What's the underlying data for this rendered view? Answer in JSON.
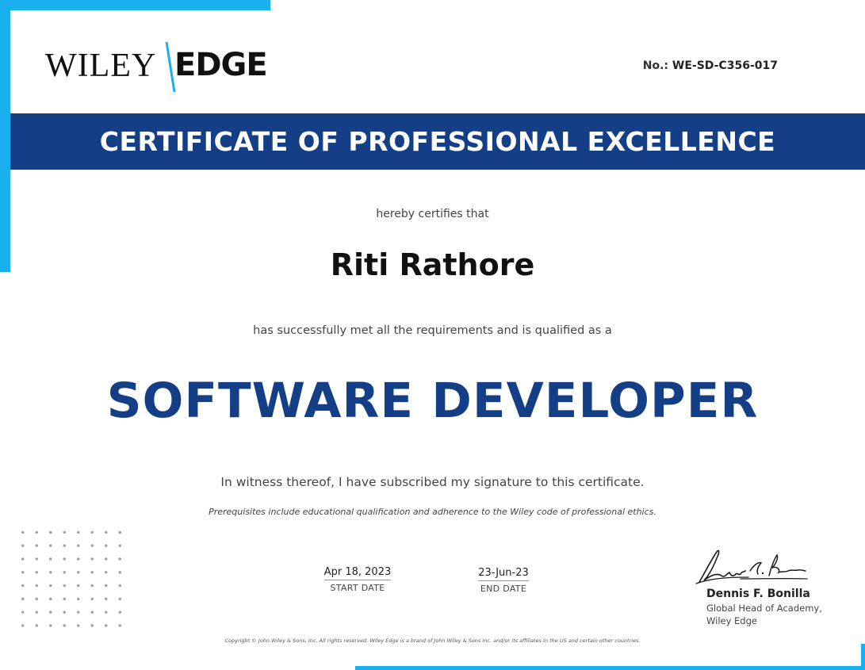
{
  "logo": {
    "wiley": "WILEY",
    "edge": "EDGE"
  },
  "certificate_no": {
    "label": "No.:",
    "value": "WE-SD-C356-017"
  },
  "banner": {
    "title": "CERTIFICATE OF PROFESSIONAL EXCELLENCE"
  },
  "body": {
    "hereby": "hereby certifies that",
    "recipient": "Riti Rathore",
    "met": "has successfully met all the requirements and is qualified as a",
    "qualification": "SOFTWARE DEVELOPER",
    "witness": "In witness thereof, I have subscribed my signature to this certificate.",
    "prerequisites": "Prerequisites include educational qualification and adherence to the Wiley code of professional ethics."
  },
  "dates": {
    "start_value": "Apr 18, 2023",
    "start_label": "START DATE",
    "end_value": "23-Jun-23",
    "end_label": "END DATE"
  },
  "signatory": {
    "name": "Dennis F. Bonilla",
    "title_line1": "Global Head of Academy,",
    "title_line2": "Wiley Edge"
  },
  "footer": {
    "copyright": "Copyright © John Wiley & Sons, Inc. All rights reserved. Wiley Edge is a brand of John Wiley & Sons Inc. and/or its affiliates in the US and certain other countries."
  },
  "colors": {
    "accent": "#1ab0f0",
    "navy": "#143f86"
  }
}
